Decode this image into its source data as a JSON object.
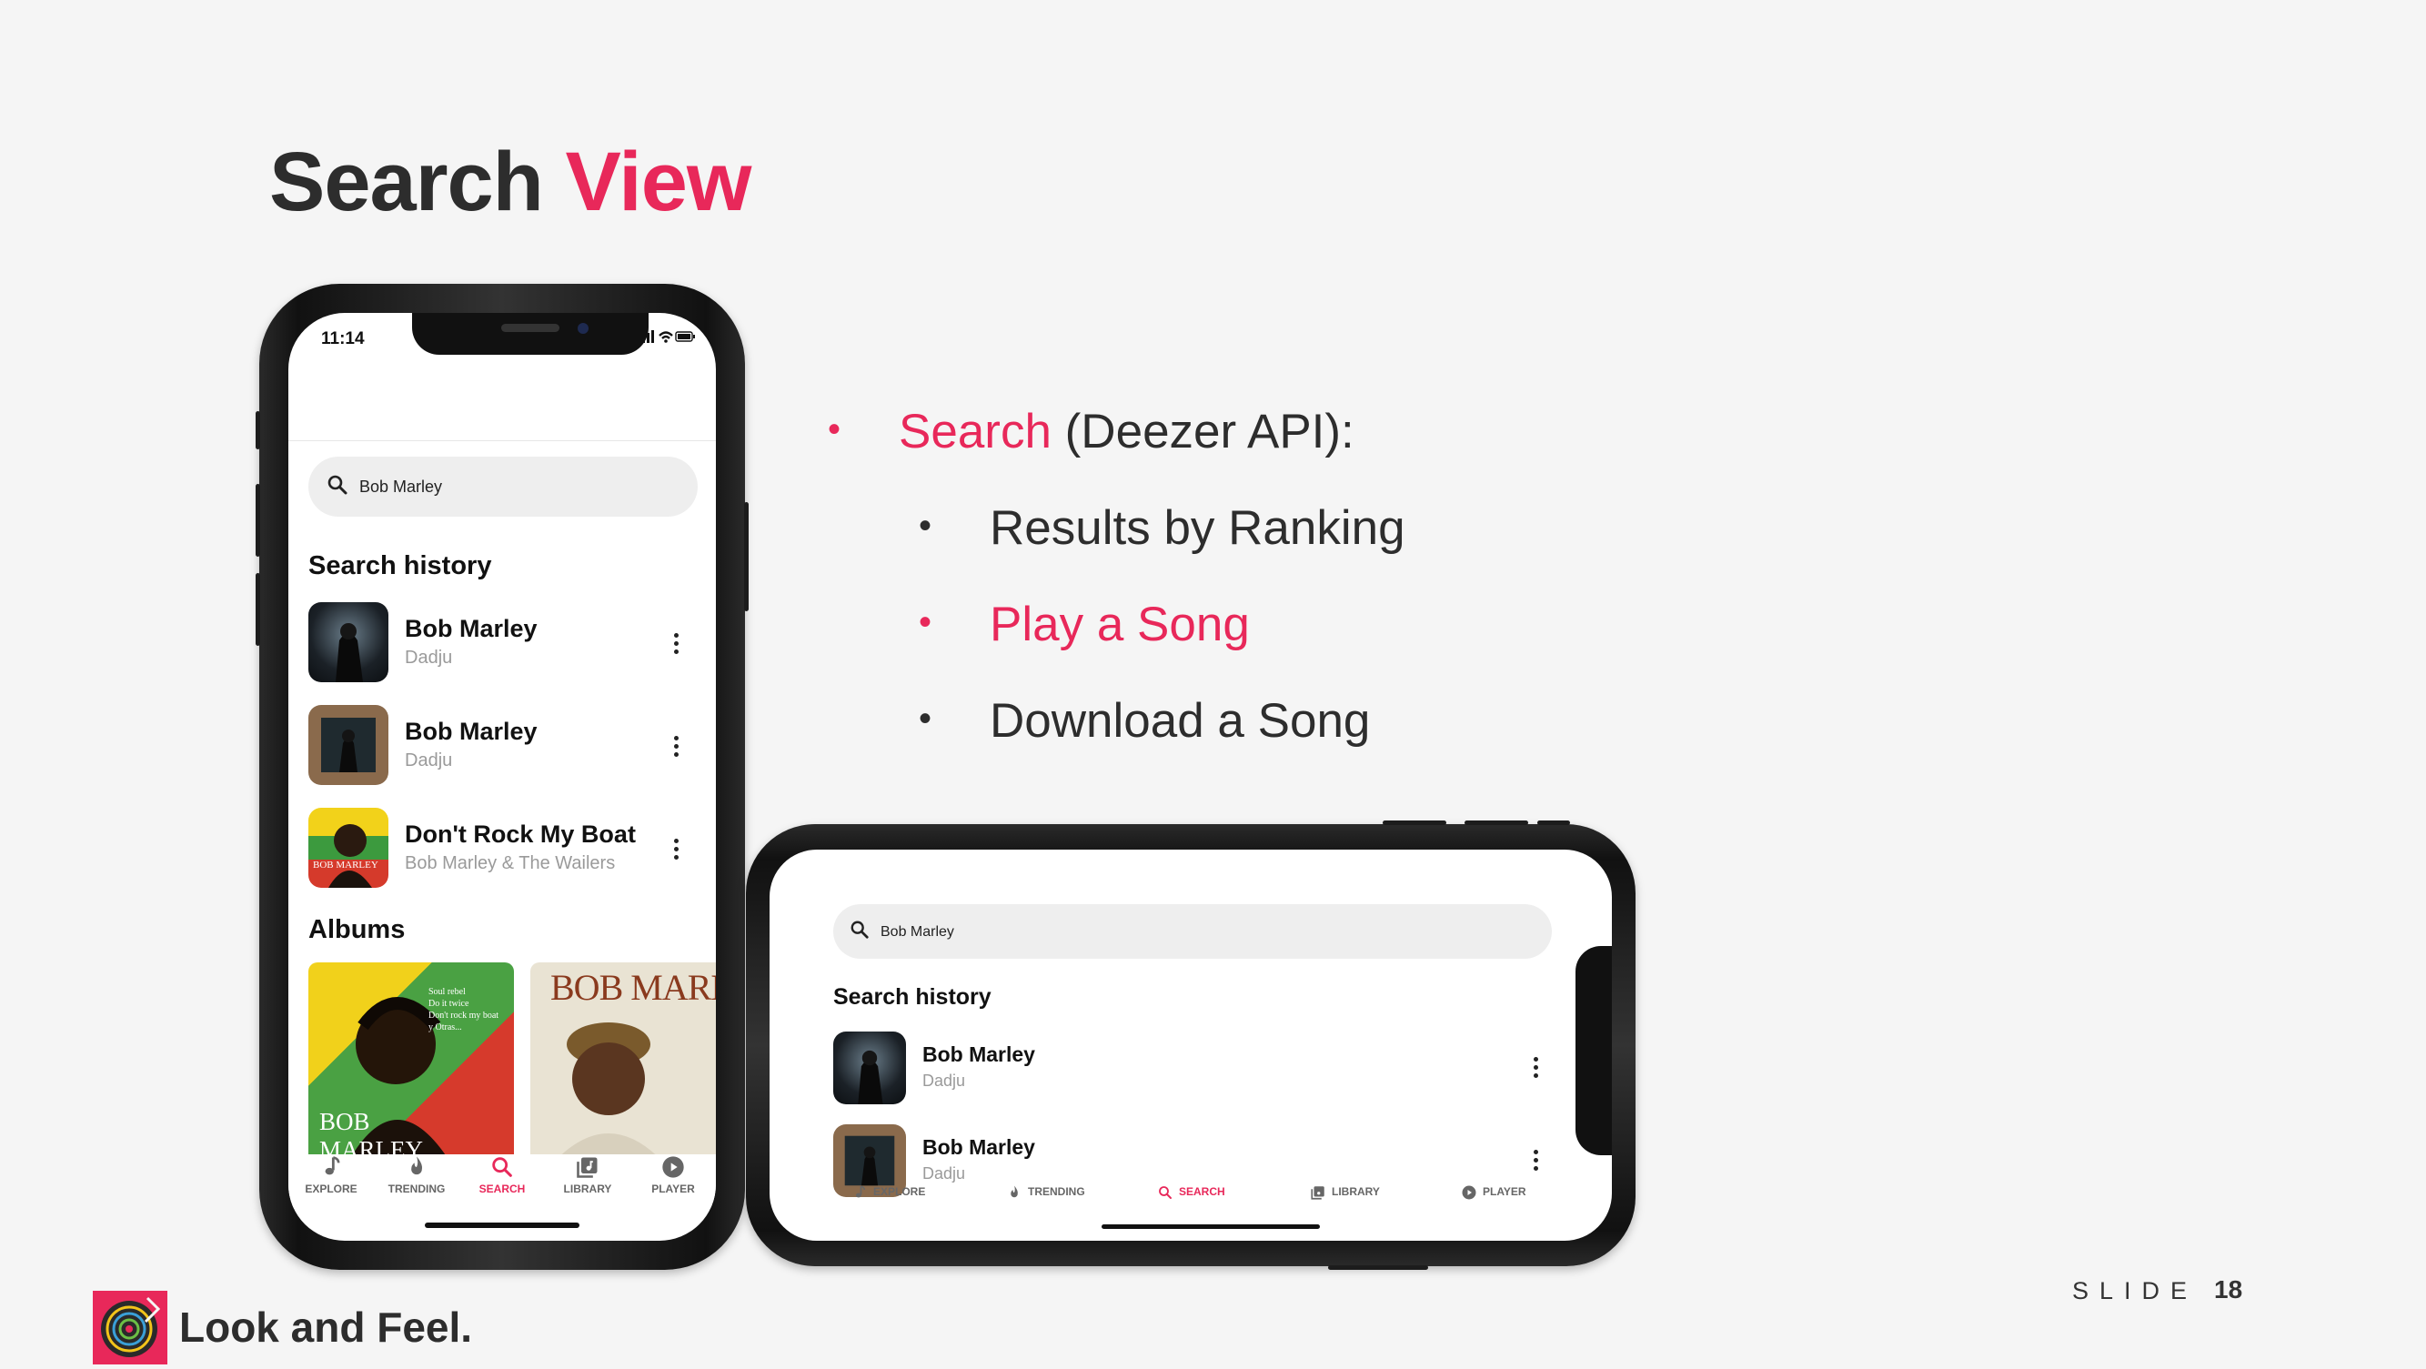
{
  "slide": {
    "title_main": "Search",
    "title_accent": "View",
    "bullets": [
      {
        "highlight": "Search",
        "text": " (Deezer API):"
      },
      {
        "text": "Results by Ranking"
      },
      {
        "text": "Play a Song"
      },
      {
        "text": "Download a Song"
      }
    ],
    "footer_text": "Look and Feel.",
    "slide_label": "SLIDE",
    "slide_number": "18"
  },
  "colors": {
    "accent": "#e8285a",
    "text": "#2d2d2d",
    "background": "#f5f5f5"
  },
  "app": {
    "status_time": "11:14",
    "search_value": "Bob Marley",
    "search_history_title": "Search history",
    "history": [
      {
        "title": "Bob Marley",
        "subtitle": "Dadju"
      },
      {
        "title": "Bob Marley",
        "subtitle": "Dadju"
      },
      {
        "title": "Don't Rock My Boat",
        "subtitle": "Bob Marley & The Wailers"
      }
    ],
    "albums_title": "Albums",
    "albums": [
      {
        "cover_text_1": "BOB",
        "cover_text_2": "MARLEY",
        "cover_note": "Soul rebel\nDo it twice\nDon't rock my boat\ny Otras..."
      },
      {
        "cover_text": "BOB MARLEY"
      }
    ],
    "thumb_caption": "BOB MARLEY",
    "tabs": [
      {
        "label": "EXPLORE",
        "icon": "music-note-icon"
      },
      {
        "label": "TRENDING",
        "icon": "flame-icon"
      },
      {
        "label": "SEARCH",
        "icon": "search-icon",
        "active": true
      },
      {
        "label": "LIBRARY",
        "icon": "library-icon"
      },
      {
        "label": "PLAYER",
        "icon": "play-circle-icon"
      }
    ]
  }
}
